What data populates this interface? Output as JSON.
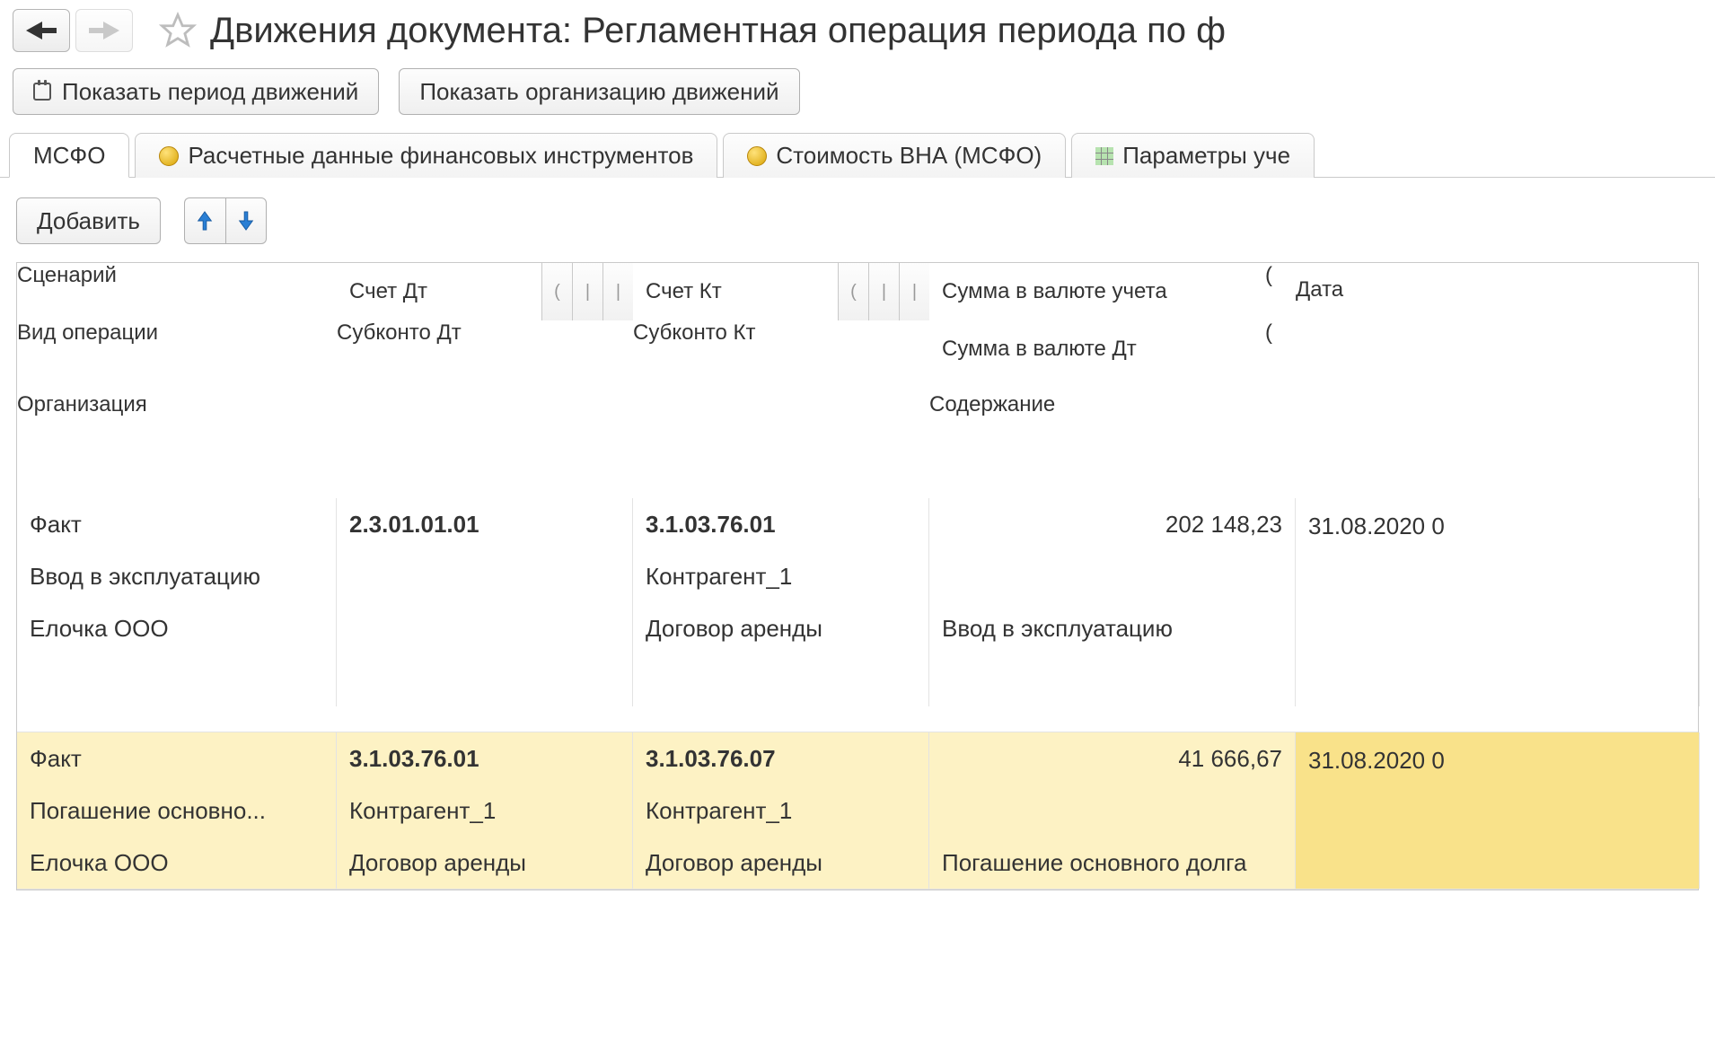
{
  "header": {
    "title": "Движения документа: Регламентная операция периода по ф"
  },
  "actions": {
    "show_period": "Показать период движений",
    "show_org": "Показать организацию движений"
  },
  "tabs": [
    {
      "label": "МСФО"
    },
    {
      "label": "Расчетные данные финансовых инструментов"
    },
    {
      "label": "Стоимость ВНА (МСФО)"
    },
    {
      "label": "Параметры уче"
    }
  ],
  "toolbar": {
    "add": "Добавить"
  },
  "columns": {
    "scenario": "Сценарий",
    "op_type": "Вид операции",
    "org": "Организация",
    "dt": "Счет Дт",
    "sub_dt": "Субконто Дт",
    "kt": "Счет Кт",
    "sub_kt": "Субконто Кт",
    "amount": "Сумма в валюте учета",
    "amount_dt": "Сумма в валюте Дт",
    "descr": "Содержание",
    "date": "Дата",
    "mini1": "(",
    "mini2": "|",
    "mini3": "|"
  },
  "rows": [
    {
      "scenario": "Факт",
      "op_type": "Ввод в эксплуатацию",
      "org": "Елочка ООО",
      "dt": "2.3.01.01.01",
      "sub_dt": "",
      "sub_dt2": "",
      "kt": "3.1.03.76.01",
      "sub_kt": "Контрагент_1",
      "sub_kt2": "Договор аренды",
      "amount": "202 148,23",
      "amount_dt": "",
      "descr": "Ввод в эксплуатацию",
      "date": "31.08.2020 0"
    },
    {
      "scenario": "Факт",
      "op_type": "Погашение основно...",
      "org": "Елочка ООО",
      "dt": "3.1.03.76.01",
      "sub_dt": "Контрагент_1",
      "sub_dt2": "Договор аренды",
      "kt": "3.1.03.76.07",
      "sub_kt": "Контрагент_1",
      "sub_kt2": "Договор аренды",
      "amount": "41 666,67",
      "amount_dt": "",
      "descr": "Погашение основного долга",
      "date": "31.08.2020 0"
    }
  ]
}
